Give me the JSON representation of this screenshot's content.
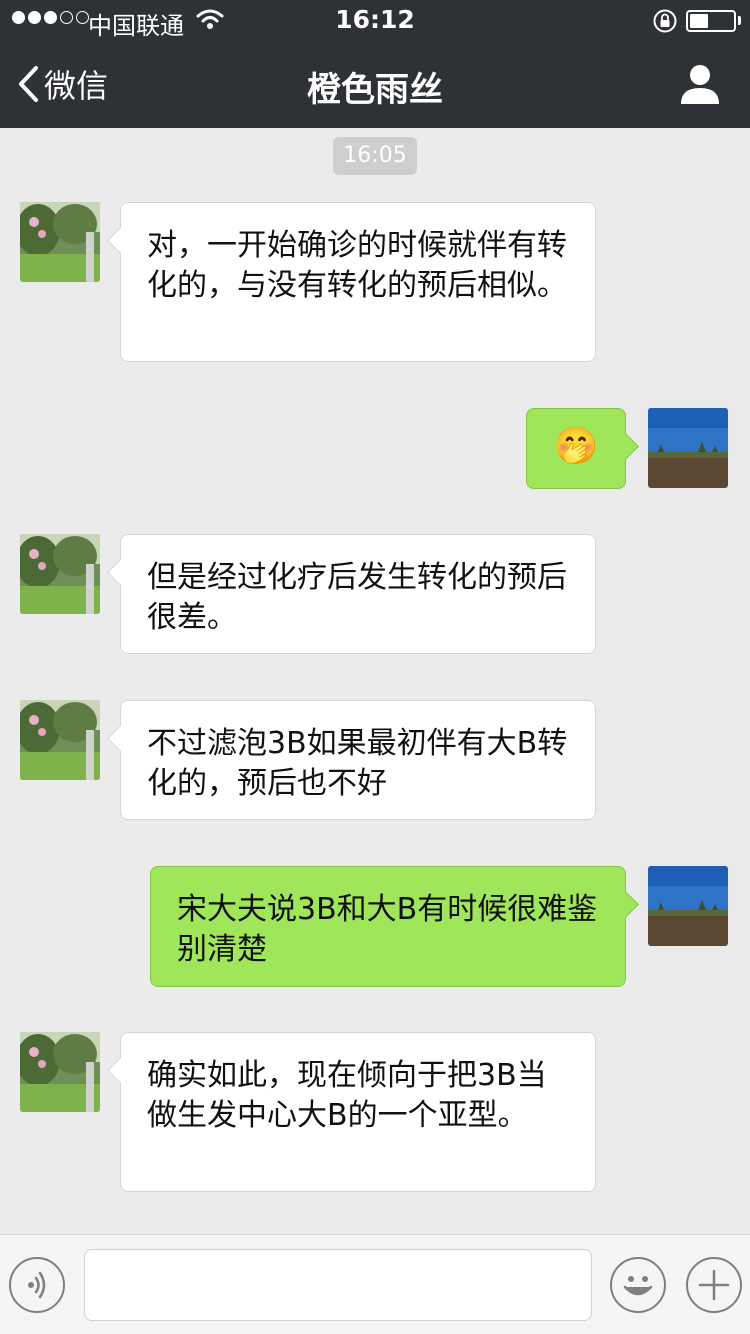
{
  "status_bar": {
    "carrier": "中国联通",
    "time": "16:12"
  },
  "nav": {
    "back_label": "微信",
    "title": "橙色雨丝"
  },
  "chat": {
    "timestamp": "16:05",
    "messages": [
      {
        "side": "left",
        "text": "对，一开始确诊的时候就伴有转化的，与没有转化的预后相似。"
      },
      {
        "side": "right",
        "text": "🤭"
      },
      {
        "side": "left",
        "text": "但是经过化疗后发生转化的预后很差。"
      },
      {
        "side": "left",
        "text": "不过滤泡3B如果最初伴有大B转化的，预后也不好"
      },
      {
        "side": "right",
        "text": "宋大夫说3B和大B有时候很难鉴别清楚"
      },
      {
        "side": "left",
        "text": "确实如此，现在倾向于把3B当做生发中心大B的一个亚型。"
      }
    ]
  },
  "input_bar": {
    "placeholder": ""
  },
  "colors": {
    "header_bg": "#2e3135",
    "chat_bg": "#ebebeb",
    "sent_bubble": "#9fe65a",
    "received_bubble": "#ffffff"
  },
  "icons": {
    "back": "chevron-left-icon",
    "profile": "person-icon",
    "voice": "voice-icon",
    "emoji": "smiley-icon",
    "more": "plus-icon"
  }
}
